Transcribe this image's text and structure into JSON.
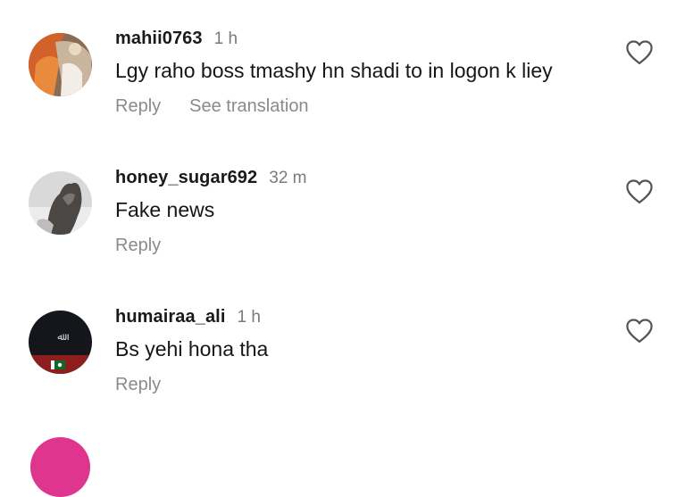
{
  "comments": [
    {
      "username": "mahii0763",
      "time": "1 h",
      "text": "Lgy raho boss tmashy hn shadi to in logon k liey",
      "reply_label": "Reply",
      "translate_label": "See translation"
    },
    {
      "username": "honey_sugar692",
      "time": "32 m",
      "text": "Fake news",
      "reply_label": "Reply"
    },
    {
      "username": "humairaa_ali",
      "time": "1 h",
      "text": "Bs yehi hona tha",
      "reply_label": "Reply"
    }
  ],
  "icons": {
    "like": "heart-outline-icon"
  },
  "colors": {
    "background": "#ffffff",
    "username": "#1a1a1a",
    "secondary_text": "#7a7a7a",
    "next_avatar_ring": "#e0358f"
  }
}
